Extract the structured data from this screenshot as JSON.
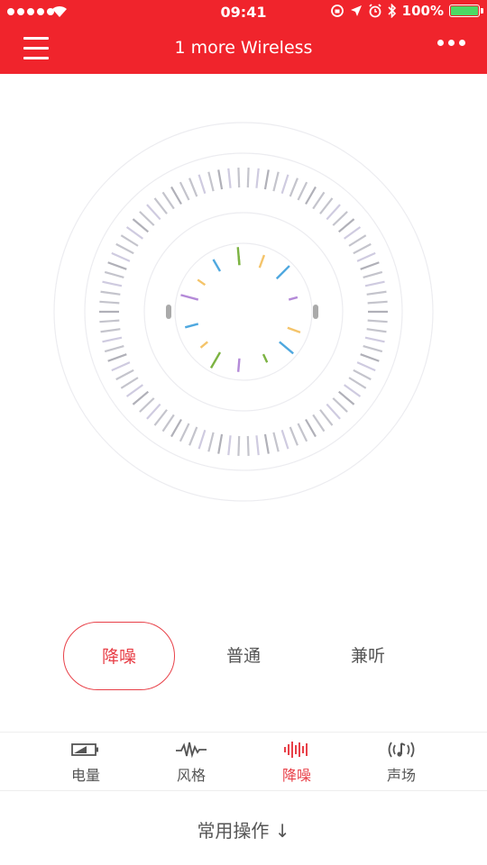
{
  "status_bar": {
    "time": "09:41",
    "battery_percent": "100%",
    "battery_level": 1.0,
    "signal_dots": 5
  },
  "nav": {
    "title": "1 more Wireless"
  },
  "modes": [
    {
      "label": "降噪",
      "active": true
    },
    {
      "label": "普通",
      "active": false
    },
    {
      "label": "兼听",
      "active": false
    }
  ],
  "tabs": [
    {
      "label": "电量",
      "icon": "battery-icon",
      "active": false
    },
    {
      "label": "风格",
      "icon": "waveform-icon",
      "active": false
    },
    {
      "label": "降噪",
      "icon": "noise-cancel-icon",
      "active": true
    },
    {
      "label": "声场",
      "icon": "sound-field-icon",
      "active": false
    }
  ],
  "common_ops": {
    "label": "常用操作 ↓"
  },
  "colors": {
    "brand": "#f0242c",
    "accent": "#e84048",
    "text": "#555555"
  }
}
